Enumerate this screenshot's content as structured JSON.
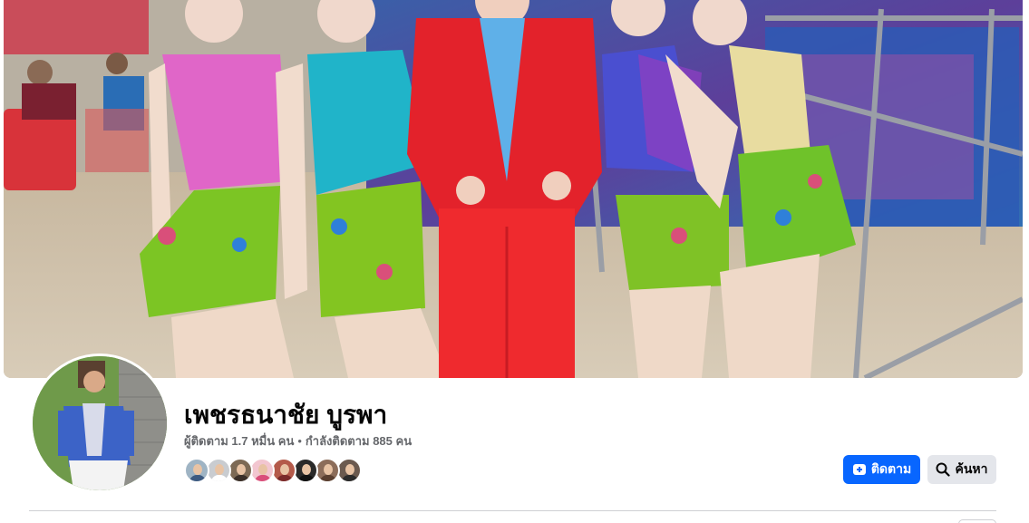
{
  "profile": {
    "name": "เพชรธนาชัย บูรพา",
    "followers_text": "ผู้ติดตาม 1.7 หมื่น คน",
    "following_text": "กำลังติดตาม 885 คน",
    "separator": "•"
  },
  "actions": {
    "follow_label": "ติดตาม",
    "search_label": "ค้นหา"
  },
  "icons": {
    "follow": "follow-plus-icon",
    "search": "magnifier-icon"
  },
  "colors": {
    "primary": "#0866ff",
    "secondary_button": "#e4e6eb",
    "text_primary": "#050505",
    "text_secondary": "#65676b"
  },
  "follower_avatars": [
    {
      "bg": "#9fb4c4",
      "shirt": "#3d5a80"
    },
    {
      "bg": "#c9ccd0",
      "shirt": "#ffffff"
    },
    {
      "bg": "#7d6a55",
      "shirt": "#3a2f28"
    },
    {
      "bg": "#f2c6d0",
      "shirt": "#d94f7a"
    },
    {
      "bg": "#b45a4a",
      "shirt": "#7a2a2a"
    },
    {
      "bg": "#2a2a2a",
      "shirt": "#111111"
    },
    {
      "bg": "#8c6d5a",
      "shirt": "#5a3f30"
    },
    {
      "bg": "#6b5a4f",
      "shirt": "#2b2b2b"
    }
  ]
}
